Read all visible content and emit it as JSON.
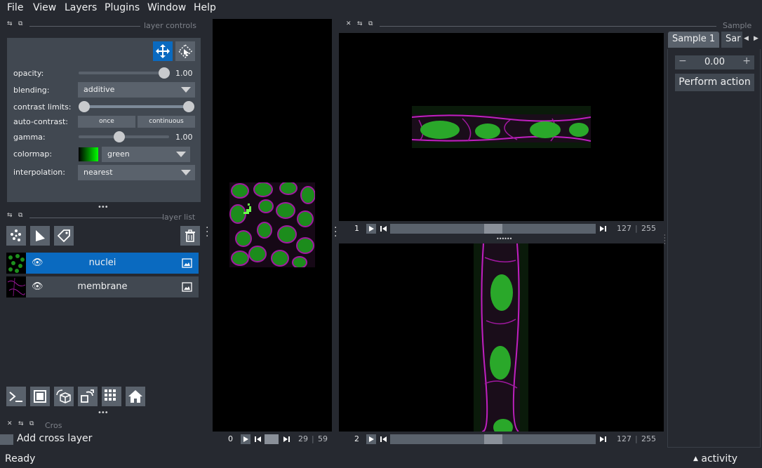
{
  "menu": [
    "File",
    "View",
    "Layers",
    "Plugins",
    "Window",
    "Help"
  ],
  "layer_controls": {
    "title": "layer controls",
    "opacity_label": "opacity:",
    "opacity": 1.0,
    "opacity_value": "1.00",
    "blending_label": "blending:",
    "blending_value": "additive",
    "contrast_label": "contrast limits:",
    "contrast_range": [
      0.0,
      1.0
    ],
    "autocontrast_label": "auto-contrast:",
    "once_label": "once",
    "continuous_label": "continuous",
    "gamma_label": "gamma:",
    "gamma": 0.45,
    "gamma_value": "1.00",
    "colormap_label": "colormap:",
    "colormap_value": "green",
    "interpolation_label": "interpolation:",
    "interpolation_value": "nearest"
  },
  "layer_list": {
    "title": "layer list",
    "layers": [
      {
        "name": "nuclei",
        "selected": true
      },
      {
        "name": "membrane",
        "selected": false
      }
    ]
  },
  "cross_widget": {
    "title": "Cros",
    "add_label": "Add cross layer"
  },
  "sample_dock": {
    "title": "Sample",
    "tabs": [
      "Sample 1",
      "Sar"
    ],
    "spin_value": "0.00",
    "perform_label": "Perform action"
  },
  "dims": {
    "left": {
      "axis": "0",
      "current": "29",
      "max": "59",
      "fraction": 0.49
    },
    "top": {
      "axis": "1",
      "current": "127",
      "max": "255",
      "fraction": 0.5
    },
    "bottom": {
      "axis": "2",
      "current": "127",
      "max": "255",
      "fraction": 0.5
    }
  },
  "status": {
    "text": "Ready",
    "activity_label": "activity"
  },
  "colors": {
    "accent": "#0a6ac0",
    "panel": "#414851",
    "background": "#262930",
    "membrane": "#c020c0",
    "nuclei": "#22c022"
  }
}
